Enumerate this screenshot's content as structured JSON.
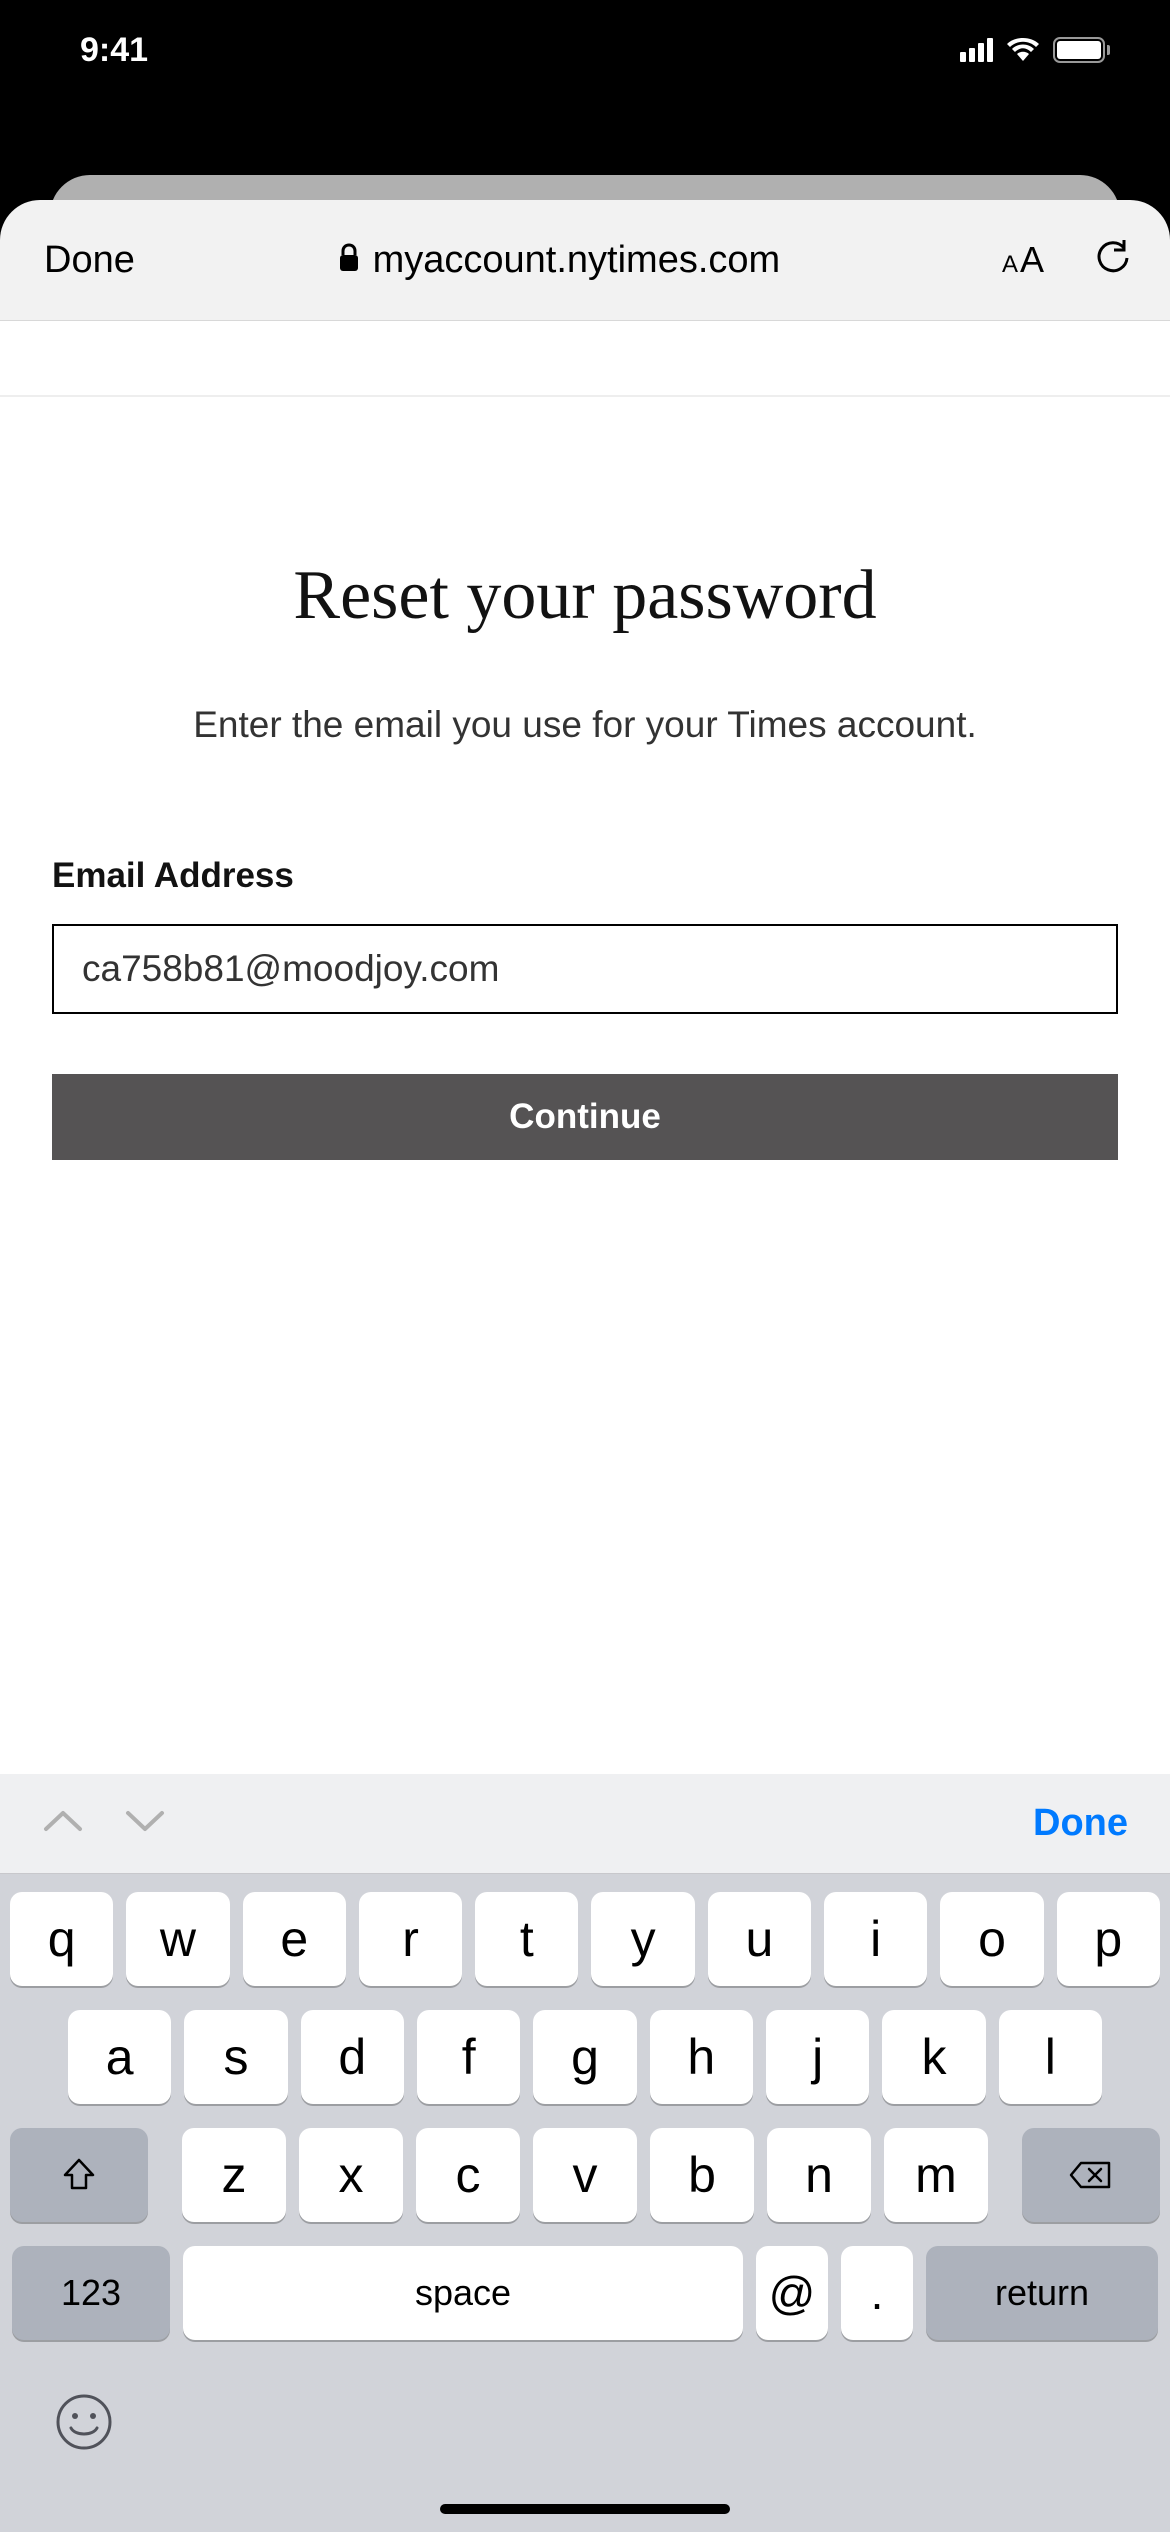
{
  "status": {
    "time": "9:41"
  },
  "browser": {
    "done_label": "Done",
    "url": "myaccount.nytimes.com"
  },
  "page": {
    "title": "Reset your password",
    "subtitle": "Enter the email you use for your Times account.",
    "email_label": "Email Address",
    "email_value": "ca758b81@moodjoy.com",
    "continue_label": "Continue"
  },
  "keyboard": {
    "done": "Done",
    "row1": [
      "q",
      "w",
      "e",
      "r",
      "t",
      "y",
      "u",
      "i",
      "o",
      "p"
    ],
    "row2": [
      "a",
      "s",
      "d",
      "f",
      "g",
      "h",
      "j",
      "k",
      "l"
    ],
    "row3": [
      "z",
      "x",
      "c",
      "v",
      "b",
      "n",
      "m"
    ],
    "numbers": "123",
    "space": "space",
    "at": "@",
    "dot": ".",
    "return": "return"
  }
}
